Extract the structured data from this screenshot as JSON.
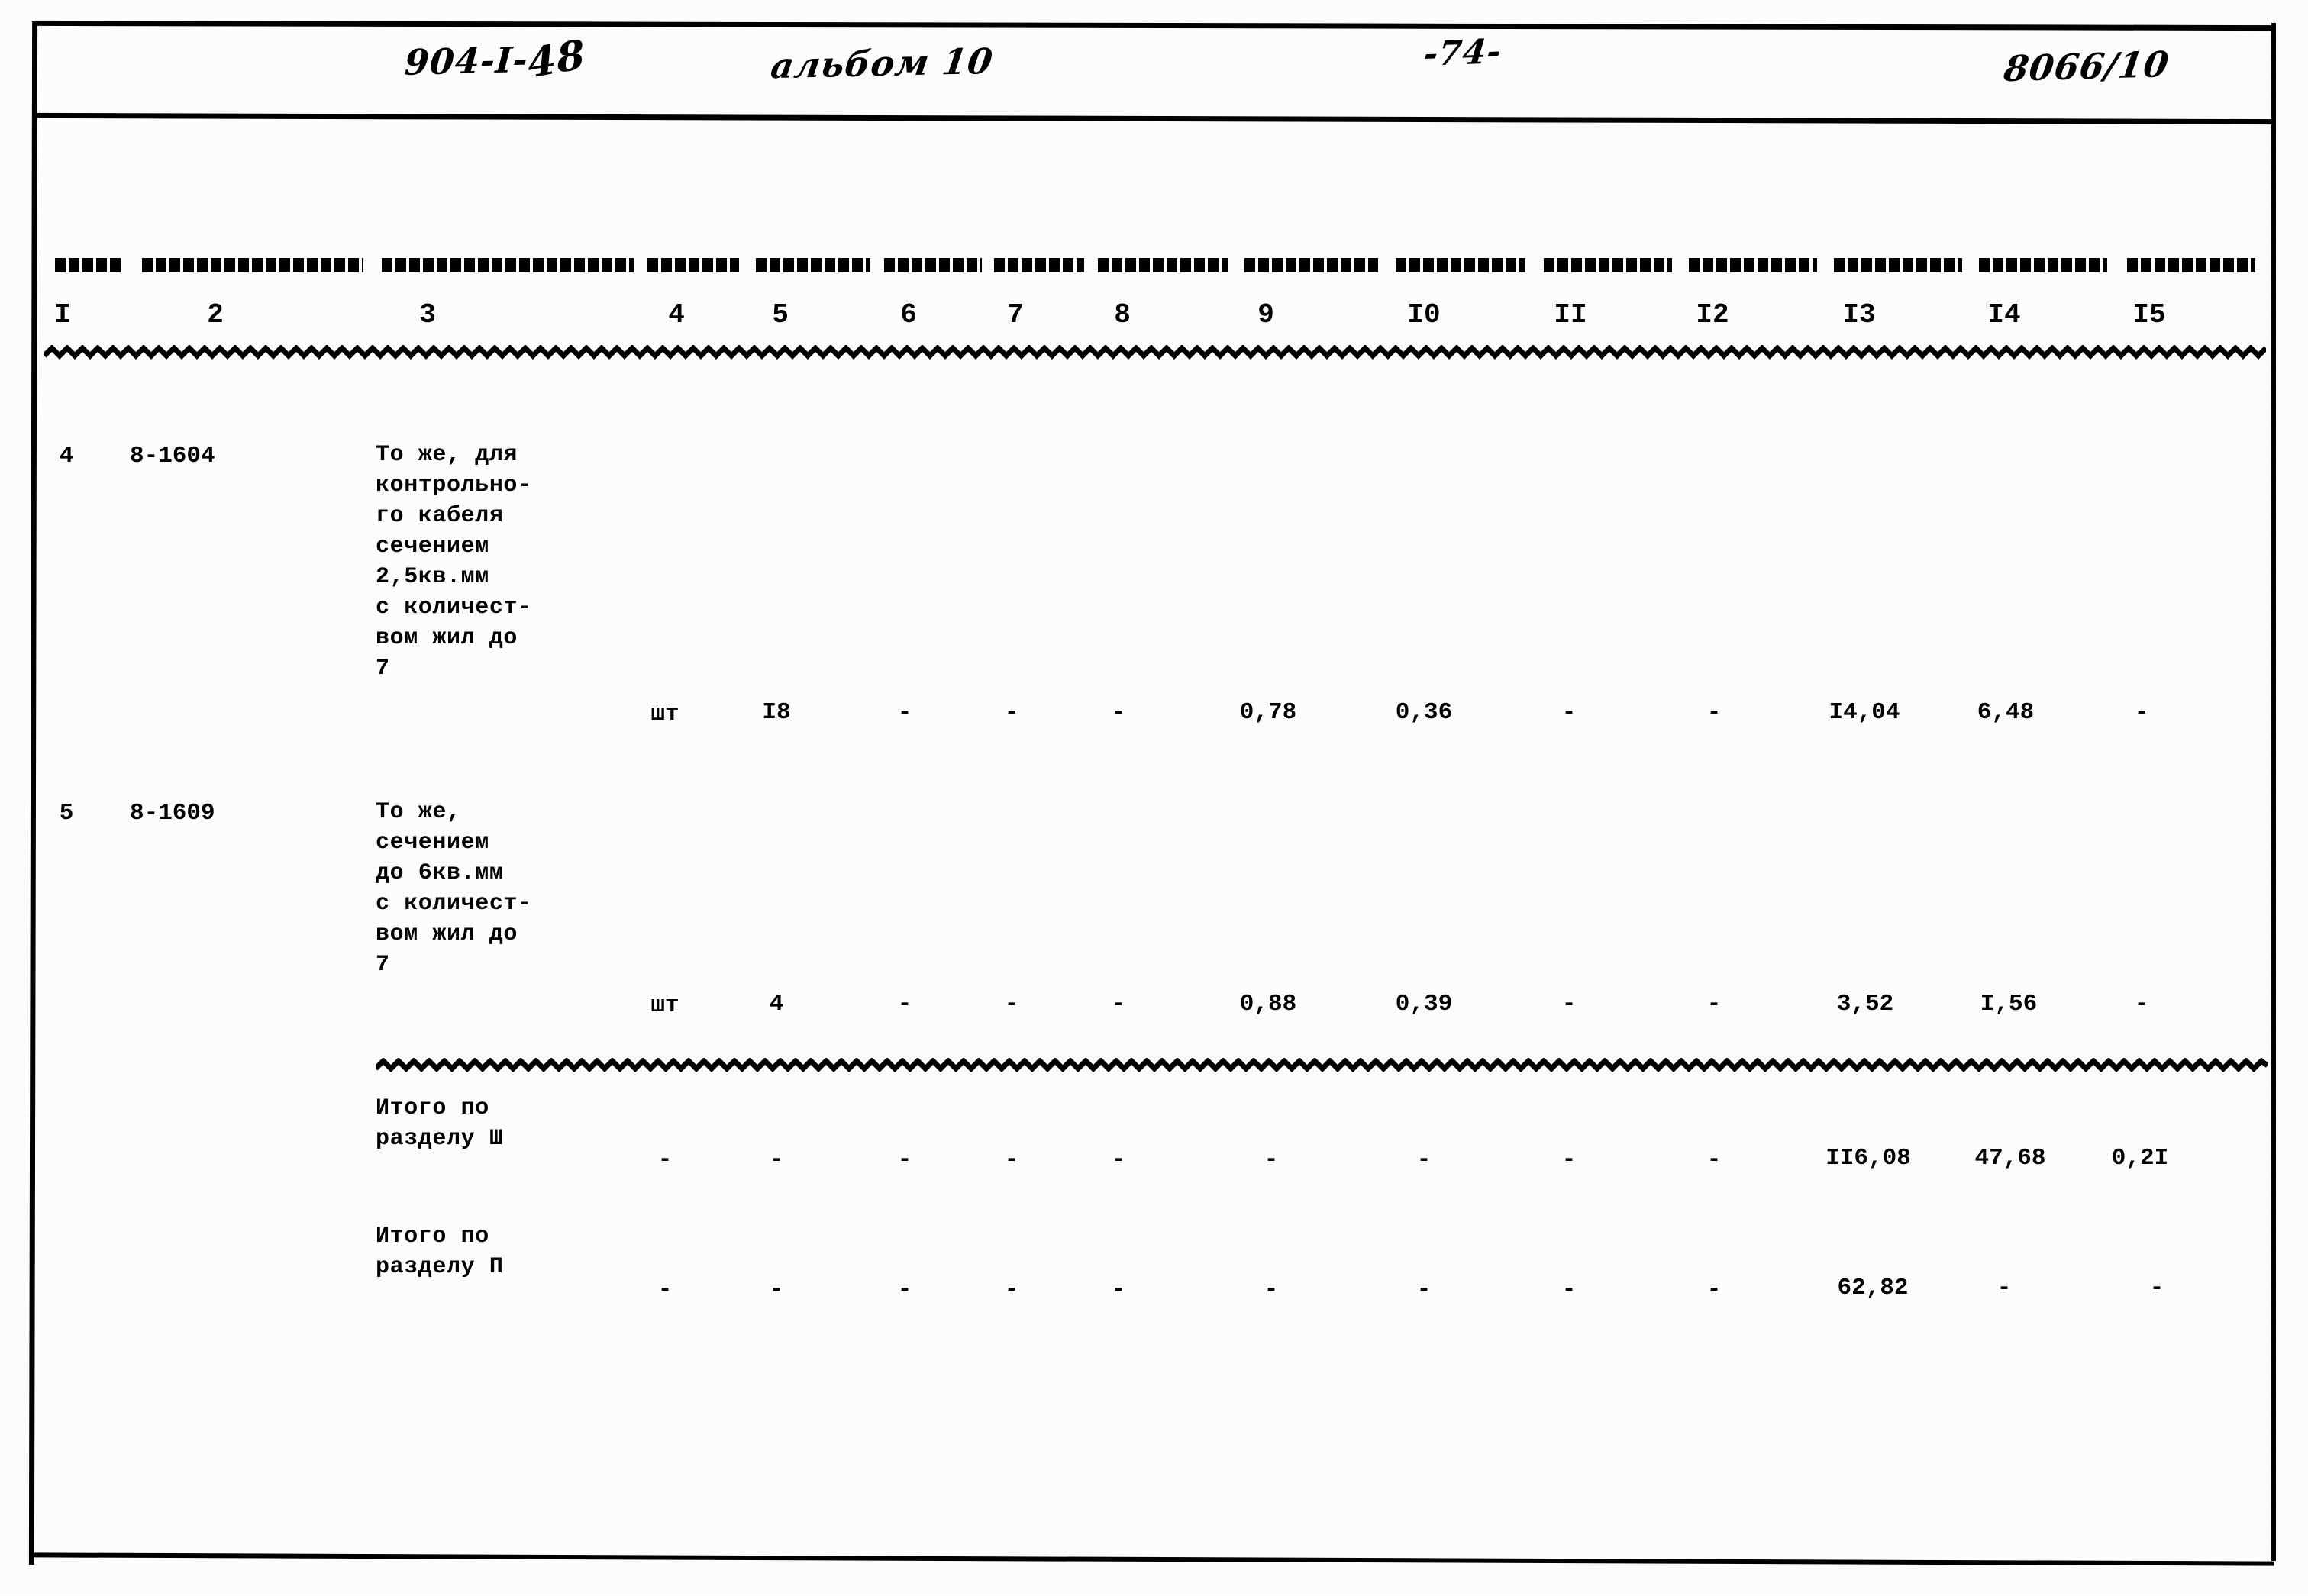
{
  "header": {
    "series_code": "904-I-",
    "series_strike": "48",
    "album": "альбом 10",
    "page_number": "-74-",
    "doc_code": "8066/10"
  },
  "table": {
    "column_numbers": [
      "I",
      "2",
      "3",
      "4",
      "5",
      "6",
      "7",
      "8",
      "9",
      "I0",
      "II",
      "I2",
      "I3",
      "I4",
      "I5"
    ],
    "rows": [
      {
        "no": "4",
        "code": "8-1604",
        "description": "То же, для\nконтрольно-\nго кабеля\nсечением\n2,5кв.мм\nс количест-\nвом жил до\n7",
        "unit": "шт",
        "c5": "I8",
        "c6": "-",
        "c7": "-",
        "c8": "-",
        "c9": "0,78",
        "c10": "0,36",
        "c11": "-",
        "c12": "-",
        "c13": "I4,04",
        "c14": "6,48",
        "c15": "-"
      },
      {
        "no": "5",
        "code": "8-1609",
        "description": "То же,\nсечением\nдо 6кв.мм\nс количест-\nвом жил до\n7",
        "unit": "шт",
        "c5": "4",
        "c6": "-",
        "c7": "-",
        "c8": "-",
        "c9": "0,88",
        "c10": "0,39",
        "c11": "-",
        "c12": "-",
        "c13": "3,52",
        "c14": "I,56",
        "c15": "-"
      }
    ],
    "totals": [
      {
        "label": "Итого по\nразделу Ш",
        "unit": "-",
        "c5": "-",
        "c6": "-",
        "c7": "-",
        "c8": "-",
        "c9": "-",
        "c10": "-",
        "c11": "-",
        "c12": "-",
        "c13": "II6,08",
        "c14": "47,68",
        "c15": "0,2I"
      },
      {
        "label": "Итого по\nразделу П",
        "unit": "-",
        "c5": "-",
        "c6": "-",
        "c7": "-",
        "c8": "-",
        "c9": "-",
        "c10": "-",
        "c11": "-",
        "c12": "-",
        "c13": "62,82",
        "c14": "-",
        "c15": "-"
      }
    ]
  },
  "colors": {
    "ink": "#000000",
    "paper": "#ffffff"
  }
}
